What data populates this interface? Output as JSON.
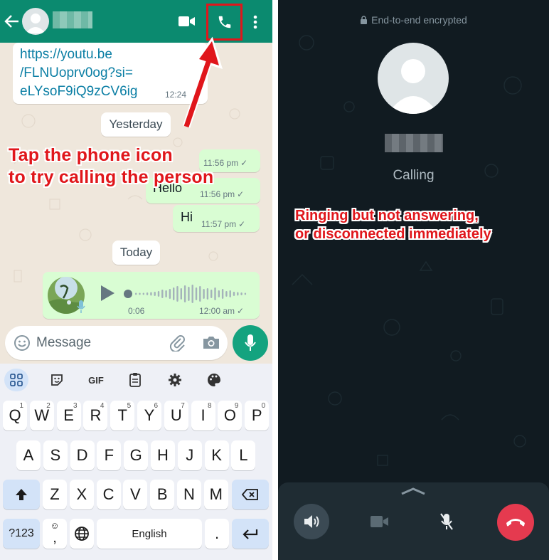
{
  "chat": {
    "link_message": {
      "text": "https://youtu.be\n/FLNUoprv0og?si=\neLYsoF9iQ9zCV6ig",
      "time": "12:24"
    },
    "date_yesterday": "Yesterday",
    "messages": [
      {
        "text": "",
        "time": "11:56 pm",
        "ticks": "✓"
      },
      {
        "text": "Hello",
        "time": "11:56 pm",
        "ticks": "✓"
      },
      {
        "text": "Hi",
        "time": "11:57 pm",
        "ticks": "✓"
      }
    ],
    "date_today": "Today",
    "voice_note": {
      "duration": "0:06",
      "time": "12:00 am",
      "ticks": "✓"
    }
  },
  "input": {
    "placeholder": "Message"
  },
  "keyboard": {
    "toolbar_gif": "GIF",
    "row1": [
      {
        "k": "Q",
        "h": "1"
      },
      {
        "k": "W",
        "h": "2"
      },
      {
        "k": "E",
        "h": "3"
      },
      {
        "k": "R",
        "h": "4"
      },
      {
        "k": "T",
        "h": "5"
      },
      {
        "k": "Y",
        "h": "6"
      },
      {
        "k": "U",
        "h": "7"
      },
      {
        "k": "I",
        "h": "8"
      },
      {
        "k": "O",
        "h": "9"
      },
      {
        "k": "P",
        "h": "0"
      }
    ],
    "row2": [
      "A",
      "S",
      "D",
      "F",
      "G",
      "H",
      "J",
      "K",
      "L"
    ],
    "row3": [
      "Z",
      "X",
      "C",
      "V",
      "B",
      "N",
      "M"
    ],
    "sym_label": "?123",
    "emoji_label": "☺",
    "comma_label": ",",
    "space_label": "English",
    "period_label": "."
  },
  "call": {
    "encrypted": "End-to-end encrypted",
    "status": "Calling"
  },
  "annotations": {
    "left_line1": "Tap the phone icon",
    "left_line2": "to try calling the person",
    "right_line1": "Ringing but not answering,",
    "right_line2": "or disconnected immediately"
  },
  "colors": {
    "header_green": "#0b8a6f",
    "outgoing_bubble": "#d9fdd3",
    "call_background": "#111b21",
    "end_call_red": "#e53a4f",
    "annotation_red": "#e0161b"
  }
}
